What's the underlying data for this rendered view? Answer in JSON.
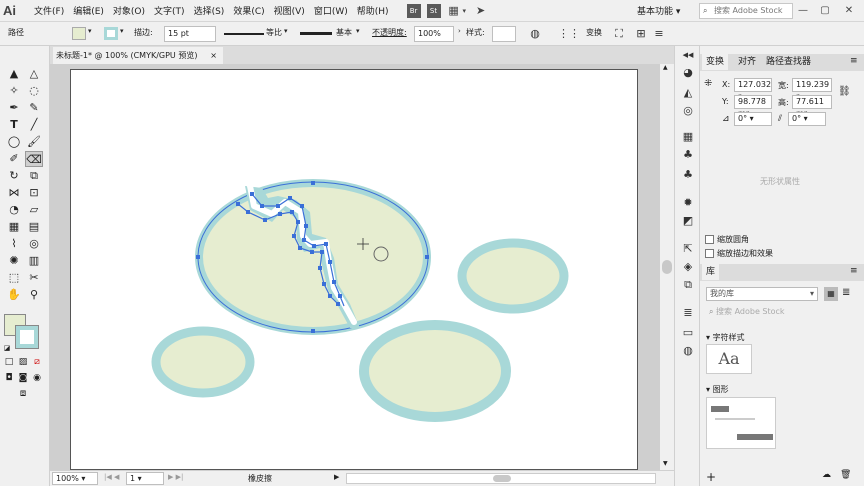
{
  "menubar": {
    "logo": "Ai",
    "items": [
      "文件(F)",
      "编辑(E)",
      "对象(O)",
      "文字(T)",
      "选择(S)",
      "效果(C)",
      "视图(V)",
      "窗口(W)",
      "帮助(H)"
    ],
    "app_buttons": [
      "Br",
      "St"
    ],
    "workspace": "基本功能",
    "search_placeholder": "搜索 Adobe Stock"
  },
  "controlbar": {
    "object_type": "路径",
    "stroke_label": "描边:",
    "stroke_value": "15 pt",
    "profile_label": "等比",
    "brush_label": "基本",
    "opacity_label": "不透明度:",
    "opacity_value": "100%",
    "style_label": "样式:",
    "transform_label": "变换"
  },
  "document": {
    "tab_title": "未标题-1* @ 100% (CMYK/GPU 预览)",
    "tab_close": "×"
  },
  "status": {
    "zoom": "100%",
    "artboard": "1",
    "tool_name": "橡皮擦"
  },
  "panels": {
    "transform": {
      "tabs": [
        "变换",
        "对齐",
        "路径查找器"
      ],
      "x_label": "X:",
      "x_value": "127.032 r",
      "y_label": "Y:",
      "y_value": "98.778 mr",
      "w_label": "宽:",
      "w_value": "119.239 r",
      "h_label": "高:",
      "h_value": "77.611 mr",
      "angle_value": "0°",
      "shear_value": "0°",
      "empty_state": "无形状属性",
      "scale_corners": "缩放圆角",
      "scale_strokes": "缩放描边和效果"
    },
    "library": {
      "title": "库",
      "selected_library": "我的库",
      "search_placeholder": "搜索 Adobe Stock",
      "section_char_styles": "字符样式",
      "char_style_sample": "Aa",
      "section_graphics": "图形"
    }
  },
  "colors": {
    "fill": "#e6edd0",
    "stroke": "#a8d8d8",
    "selection": "#3a6fd8"
  }
}
